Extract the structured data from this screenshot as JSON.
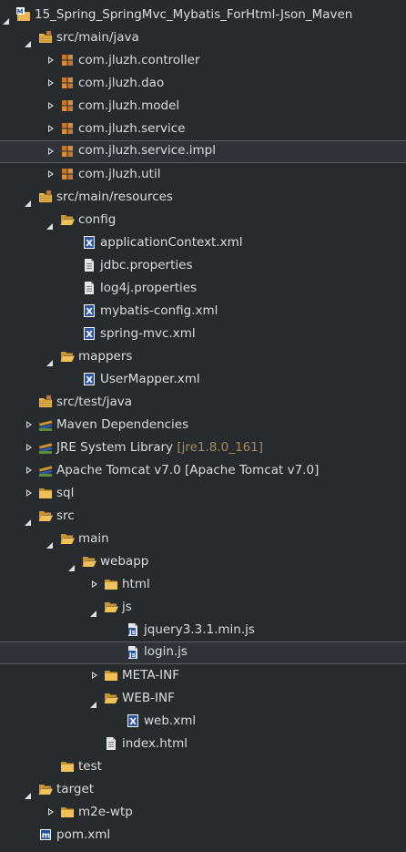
{
  "colors": {
    "background": "#272b2e",
    "text": "#dcdcdc",
    "decoration": "#a48b5e",
    "folder": "#e8b64c",
    "package": "#c9732b",
    "selection_border": "#5a5e62"
  },
  "tree": [
    {
      "label": "15_Spring_SpringMvc_Mybatis_ForHtml-Json_Maven",
      "icon": "maven-project-icon",
      "depth": 0,
      "state": "open"
    },
    {
      "label": "src/main/java",
      "icon": "source-folder-icon",
      "depth": 1,
      "state": "open"
    },
    {
      "label": "com.jluzh.controller",
      "icon": "package-icon",
      "depth": 2,
      "state": "closed"
    },
    {
      "label": "com.jluzh.dao",
      "icon": "package-icon",
      "depth": 2,
      "state": "closed"
    },
    {
      "label": "com.jluzh.model",
      "icon": "package-icon",
      "depth": 2,
      "state": "closed"
    },
    {
      "label": "com.jluzh.service",
      "icon": "package-icon",
      "depth": 2,
      "state": "closed"
    },
    {
      "label": "com.jluzh.service.impl",
      "icon": "package-icon",
      "depth": 2,
      "state": "closed",
      "highlight": true
    },
    {
      "label": "com.jluzh.util",
      "icon": "package-icon",
      "depth": 2,
      "state": "closed"
    },
    {
      "label": "src/main/resources",
      "icon": "source-folder-icon",
      "depth": 1,
      "state": "open"
    },
    {
      "label": "config",
      "icon": "folder-open-icon",
      "depth": 2,
      "state": "open"
    },
    {
      "label": "applicationContext.xml",
      "icon": "xml-file-icon",
      "depth": 3,
      "state": "none"
    },
    {
      "label": "jdbc.properties",
      "icon": "text-file-icon",
      "depth": 3,
      "state": "none"
    },
    {
      "label": "log4j.properties",
      "icon": "text-file-icon",
      "depth": 3,
      "state": "none"
    },
    {
      "label": "mybatis-config.xml",
      "icon": "xml-file-icon",
      "depth": 3,
      "state": "none"
    },
    {
      "label": "spring-mvc.xml",
      "icon": "xml-file-icon",
      "depth": 3,
      "state": "none"
    },
    {
      "label": "mappers",
      "icon": "folder-open-icon",
      "depth": 2,
      "state": "open"
    },
    {
      "label": "UserMapper.xml",
      "icon": "xml-file-icon",
      "depth": 3,
      "state": "none"
    },
    {
      "label": "src/test/java",
      "icon": "source-folder-icon",
      "depth": 1,
      "state": "none"
    },
    {
      "label": "Maven Dependencies",
      "icon": "library-icon",
      "depth": 1,
      "state": "closed"
    },
    {
      "label": "JRE System Library",
      "decoration": "[jre1.8.0_161]",
      "icon": "library-icon",
      "depth": 1,
      "state": "closed"
    },
    {
      "label": "Apache Tomcat v7.0 [Apache Tomcat v7.0]",
      "icon": "library-icon",
      "depth": 1,
      "state": "closed"
    },
    {
      "label": "sql",
      "icon": "folder-icon",
      "depth": 1,
      "state": "closed"
    },
    {
      "label": "src",
      "icon": "folder-open-icon",
      "depth": 1,
      "state": "open"
    },
    {
      "label": "main",
      "icon": "folder-open-icon",
      "depth": 2,
      "state": "open"
    },
    {
      "label": "webapp",
      "icon": "folder-open-icon",
      "depth": 3,
      "state": "open"
    },
    {
      "label": "html",
      "icon": "folder-icon",
      "depth": 4,
      "state": "closed"
    },
    {
      "label": "js",
      "icon": "folder-open-icon",
      "depth": 4,
      "state": "open"
    },
    {
      "label": "jquery3.3.1.min.js",
      "icon": "js-file-icon",
      "depth": 5,
      "state": "none"
    },
    {
      "label": "login.js",
      "icon": "js-file-icon",
      "depth": 5,
      "state": "none",
      "highlight": true
    },
    {
      "label": "META-INF",
      "icon": "folder-icon",
      "depth": 4,
      "state": "closed"
    },
    {
      "label": "WEB-INF",
      "icon": "folder-open-icon",
      "depth": 4,
      "state": "open"
    },
    {
      "label": "web.xml",
      "icon": "xml-file-icon",
      "depth": 5,
      "state": "none"
    },
    {
      "label": "index.html",
      "icon": "text-file-icon",
      "depth": 4,
      "state": "none"
    },
    {
      "label": "test",
      "icon": "folder-icon",
      "depth": 2,
      "state": "none"
    },
    {
      "label": "target",
      "icon": "folder-open-icon",
      "depth": 1,
      "state": "open"
    },
    {
      "label": "m2e-wtp",
      "icon": "folder-icon",
      "depth": 2,
      "state": "closed"
    },
    {
      "label": "pom.xml",
      "icon": "maven-pom-icon",
      "depth": 1,
      "state": "none"
    }
  ]
}
